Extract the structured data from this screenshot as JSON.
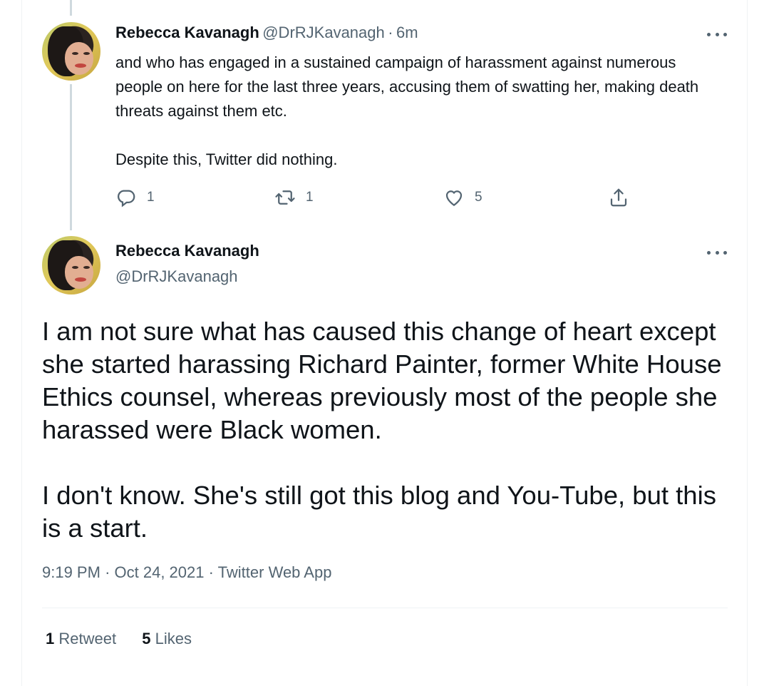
{
  "tweet1": {
    "name": "Rebecca Kavanagh",
    "handle": "@DrRJKavanagh",
    "separator": "·",
    "time": "6m",
    "paragraphs": [
      "and who has engaged in a sustained campaign of harassment against numerous people on here for the last three years, accusing them of swatting her, making death threats against them etc.",
      "Despite this, Twitter did nothing."
    ],
    "actions": {
      "reply_count": "1",
      "retweet_count": "1",
      "like_count": "5",
      "reply_icon": "reply-icon",
      "retweet_icon": "retweet-icon",
      "like_icon": "heart-icon",
      "share_icon": "share-icon"
    }
  },
  "tweet2": {
    "name": "Rebecca Kavanagh",
    "handle": "@DrRJKavanagh",
    "paragraphs": [
      "I am not sure what has caused this change of heart except she started harassing Richard Painter, former White House Ethics counsel, whereas previously most of the people she harassed were Black women.",
      "I don't know. She's still got this blog and You-Tube, but this is a start."
    ],
    "time": "9:19 PM",
    "date": "Oct 24, 2021",
    "source": "Twitter Web App",
    "separator": "·",
    "retweets": {
      "count": "1",
      "label": "Retweet"
    },
    "likes": {
      "count": "5",
      "label": "Likes"
    }
  },
  "colors": {
    "text": "#0f1419",
    "secondary": "#536471",
    "border": "#eff3f4",
    "thread_line": "#cfd9de"
  }
}
